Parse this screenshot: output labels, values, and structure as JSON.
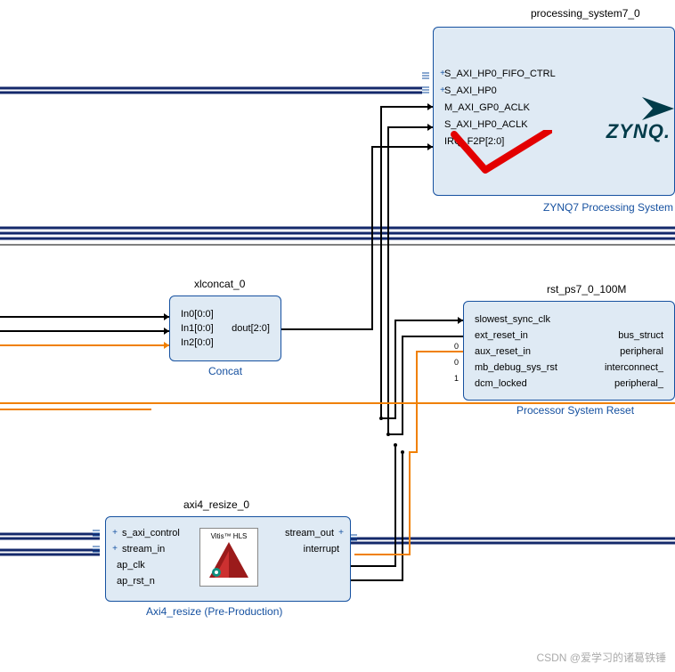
{
  "diagram": {
    "blocks": {
      "ps7": {
        "instance": "processing_system7_0",
        "type": "ZYNQ7 Processing System",
        "logo": "ZYNQ.",
        "ports_left": [
          "S_AXI_HP0_FIFO_CTRL",
          "S_AXI_HP0",
          "M_AXI_GP0_ACLK",
          "S_AXI_HP0_ACLK",
          "IRQ_F2P[2:0]"
        ]
      },
      "xlconcat": {
        "instance": "xlconcat_0",
        "type": "Concat",
        "ports_left": [
          "In0[0:0]",
          "In1[0:0]",
          "In2[0:0]"
        ],
        "ports_right": [
          "dout[2:0]"
        ]
      },
      "rst": {
        "instance": "rst_ps7_0_100M",
        "type": "Processor System Reset",
        "ports_left": [
          "slowest_sync_clk",
          "ext_reset_in",
          "aux_reset_in",
          "mb_debug_sys_rst",
          "dcm_locked"
        ],
        "ports_right": [
          "bus_struct",
          "peripheral",
          "interconnect_",
          "peripheral_"
        ],
        "consts_left": [
          "",
          "",
          "0",
          "0",
          "1"
        ]
      },
      "resize": {
        "instance": "axi4_resize_0",
        "type": "Axi4_resize (Pre-Production)",
        "vitis": "Vitis™ HLS",
        "ports_left": [
          "s_axi_control",
          "stream_in",
          "ap_clk",
          "ap_rst_n"
        ],
        "ports_right": [
          "stream_out",
          "interrupt"
        ]
      }
    }
  },
  "watermark": "CSDN @爱学习的诸葛铁锤"
}
